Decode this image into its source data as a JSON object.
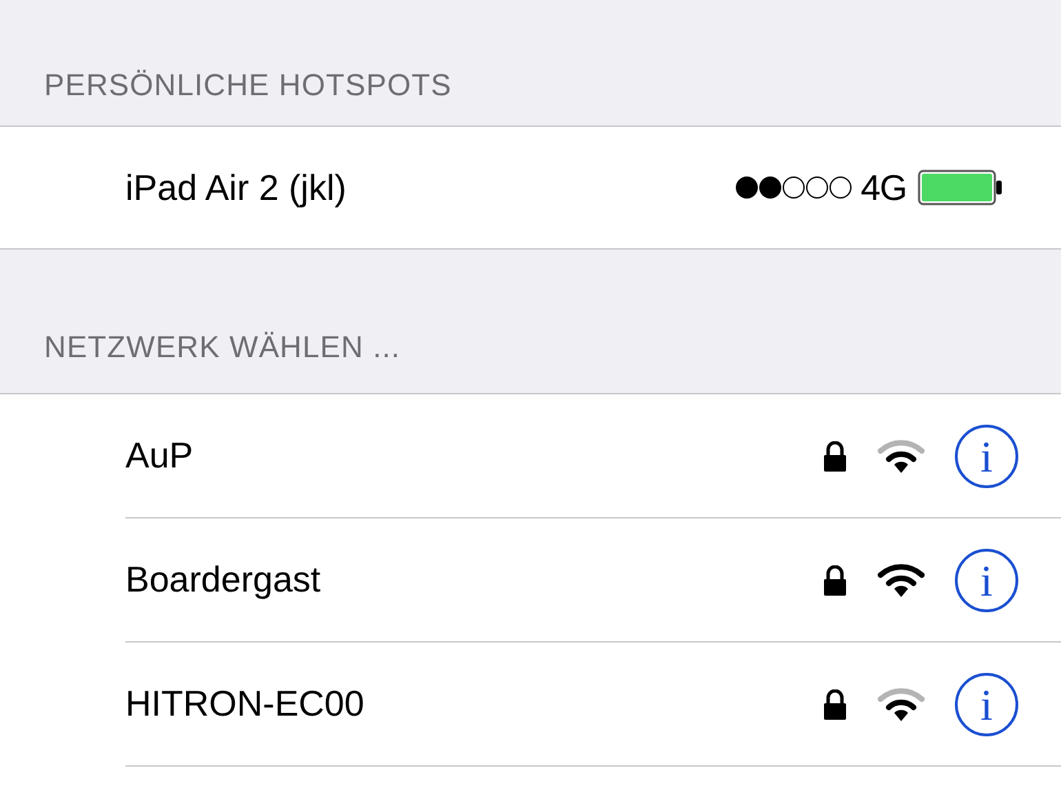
{
  "hotspots": {
    "header": "PERSÖNLICHE HOTSPOTS",
    "items": [
      {
        "name": "iPad Air 2 (jkl)",
        "network": "4G"
      }
    ]
  },
  "networks": {
    "header": "NETZWERK WÄHLEN ...",
    "items": [
      {
        "name": "AuP",
        "locked": true,
        "full_signal": false,
        "info": "i"
      },
      {
        "name": "Boardergast",
        "locked": true,
        "full_signal": true,
        "info": "i"
      },
      {
        "name": "HITRON-EC00",
        "locked": true,
        "full_signal": false,
        "info": "i"
      }
    ]
  }
}
